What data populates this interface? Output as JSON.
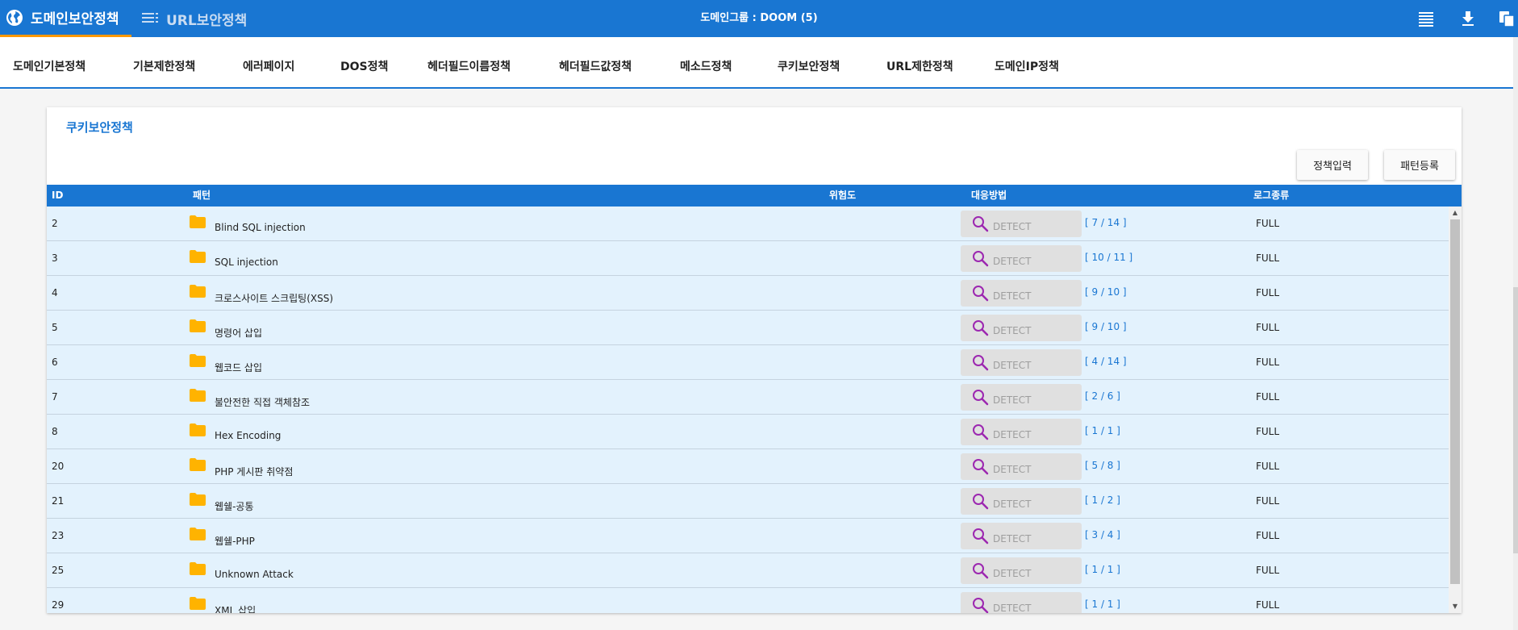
{
  "topbar": {
    "active_tab": "도메인보안정책",
    "other_tab": "URL보안정책",
    "group_title": "도메인그룹 : DOOM (5)",
    "icons": [
      "list-view-icon",
      "download-icon",
      "copy-icon"
    ]
  },
  "subnav": {
    "items": [
      {
        "label": "도메인기본정책"
      },
      {
        "label": "기본제한정책"
      },
      {
        "label": "에러페이지"
      },
      {
        "label": "DOS정책"
      },
      {
        "label": "헤더필드이름정책"
      },
      {
        "label": "헤더필드값정책"
      },
      {
        "label": "메소드정책"
      },
      {
        "label": "쿠키보안정책"
      },
      {
        "label": "URL제한정책"
      },
      {
        "label": "도메인IP정책"
      }
    ]
  },
  "panel": {
    "title": "쿠키보안정책",
    "btn_policy_input": "정책입력",
    "btn_pattern_register": "패턴등록"
  },
  "table": {
    "headers": {
      "id": "ID",
      "pattern": "패턴",
      "risk": "위험도",
      "action": "대응방법",
      "log": "로그종류"
    },
    "rows": [
      {
        "id": "2",
        "pattern": "Blind SQL injection",
        "action": "DETECT",
        "count": "[  7 / 14  ]",
        "log": "FULL"
      },
      {
        "id": "3",
        "pattern": "SQL injection",
        "action": "DETECT",
        "count": "[ 10 / 11 ]",
        "log": "FULL"
      },
      {
        "id": "4",
        "pattern": "크로스사이트 스크립팅(XSS)",
        "action": "DETECT",
        "count": "[  9 / 10  ]",
        "log": "FULL"
      },
      {
        "id": "5",
        "pattern": "명령어 삽입",
        "action": "DETECT",
        "count": "[  9 / 10  ]",
        "log": "FULL"
      },
      {
        "id": "6",
        "pattern": "웹코드 삽입",
        "action": "DETECT",
        "count": "[  4 / 14  ]",
        "log": "FULL"
      },
      {
        "id": "7",
        "pattern": "불안전한 직접 객체참조",
        "action": "DETECT",
        "count": "[   2 / 6   ]",
        "log": "FULL"
      },
      {
        "id": "8",
        "pattern": "Hex Encoding",
        "action": "DETECT",
        "count": "[   1 / 1   ]",
        "log": "FULL"
      },
      {
        "id": "20",
        "pattern": "PHP 게시판 취약점",
        "action": "DETECT",
        "count": "[   5 / 8   ]",
        "log": "FULL"
      },
      {
        "id": "21",
        "pattern": "웹쉘-공통",
        "action": "DETECT",
        "count": "[   1 / 2   ]",
        "log": "FULL"
      },
      {
        "id": "23",
        "pattern": "웹쉘-PHP",
        "action": "DETECT",
        "count": "[   3 / 4   ]",
        "log": "FULL"
      },
      {
        "id": "25",
        "pattern": "Unknown Attack",
        "action": "DETECT",
        "count": "[   1 / 1   ]",
        "log": "FULL"
      },
      {
        "id": "29",
        "pattern": "XML 삽입",
        "action": "DETECT",
        "count": "[   1 / 1   ]",
        "log": "FULL"
      }
    ]
  },
  "colors": {
    "primary": "#1976d2",
    "row_bg": "#e3f2fd",
    "folder": "#ffb300",
    "magnifier": "#9c27b0",
    "tab_indicator": "#ff9800"
  }
}
